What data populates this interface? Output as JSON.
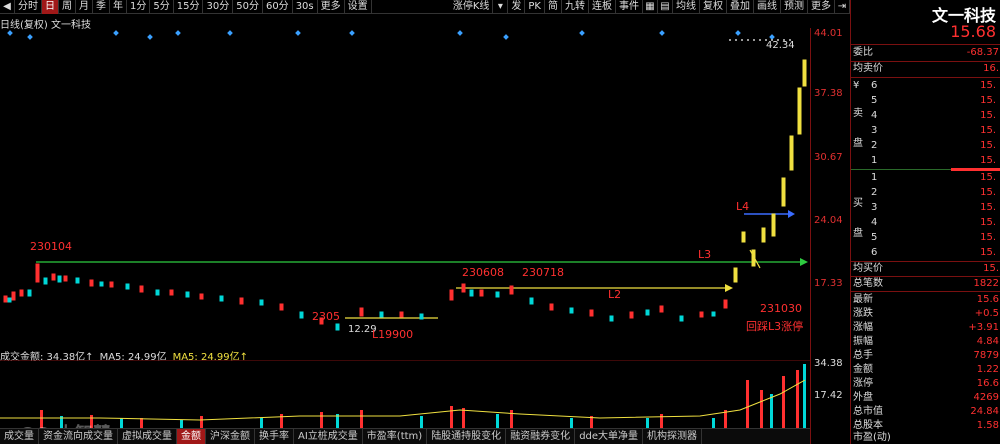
{
  "toolbar": {
    "items": [
      "分时",
      "日",
      "周",
      "月",
      "季",
      "年",
      "1分",
      "5分",
      "15分",
      "30分",
      "50分",
      "60分",
      "30s",
      "更多",
      "设置"
    ],
    "right_items": [
      "涨停K线",
      "发",
      "PK",
      "简",
      "九转",
      "连板",
      "事件",
      "均线",
      "复权",
      "叠加",
      "画线",
      "预测",
      "更多"
    ],
    "active": "日"
  },
  "stock_label": "日线(复权)  文一科技",
  "axis": {
    "price_labels": [
      "44.01",
      "42.34",
      "37.38",
      "30.67",
      "24.04",
      "17.33"
    ],
    "volume_labels": [
      "34.38",
      "17.42"
    ]
  },
  "annotations": {
    "a1": "230104",
    "a2": "230608",
    "a3": "230718",
    "a4": "L4",
    "a5": "L3",
    "a6": "L2",
    "a7": "231030",
    "a8": "回踩L3涨停",
    "a9": "2305",
    "a10": "12.29",
    "a11": "L19900"
  },
  "vol_header": {
    "name": "成交金额: 34.38亿↑",
    "ma1": "MA5: 24.99亿",
    "ma2": "MA5: 24.99亿↑"
  },
  "bottom_tabs": [
    "成交量",
    "资金流向成交量",
    "虚拟成交量",
    "金额",
    "沪深金额",
    "换手率",
    "AI立桩成交量",
    "市盈率(ttm)",
    "陆股通持股变化",
    "融资融券变化",
    "dde大单净量",
    "机构探测器"
  ],
  "active_tab": "金额",
  "right_panel": {
    "title": "文一科技",
    "price": "15.68",
    "weibi_label": "委比",
    "weibi_val": "-68.37",
    "avg_label": "均卖价",
    "avg_val": "16.",
    "sell_label": "卖",
    "sell_label2": "盘",
    "sell_marker": "¥",
    "sell_nums": [
      "6",
      "5",
      "4",
      "3",
      "2",
      "1"
    ],
    "sell_vals": [
      "15.",
      "15.",
      "15.",
      "15.",
      "15.",
      "15."
    ],
    "buy_label": "买",
    "buy_label2": "盘",
    "buy_nums": [
      "1",
      "2",
      "3",
      "4",
      "5",
      "6"
    ],
    "buy_vals": [
      "15.",
      "15.",
      "15.",
      "15.",
      "15.",
      "15."
    ],
    "stats": [
      {
        "label": "均买价",
        "val": "15."
      },
      {
        "label": "总笔数",
        "val": "1822"
      },
      {
        "label": "最新",
        "val": "15.6"
      },
      {
        "label": "涨跌",
        "val": "+0.5"
      },
      {
        "label": "涨幅",
        "val": "+3.91"
      },
      {
        "label": "振幅",
        "val": "4.84"
      },
      {
        "label": "总手",
        "val": "7879"
      },
      {
        "label": "金额",
        "val": "1.22"
      },
      {
        "label": "涨停",
        "val": "16.6"
      },
      {
        "label": "外盘",
        "val": "4269"
      },
      {
        "label": "总市值",
        "val": "24.84"
      },
      {
        "label": "总股本",
        "val": "1.58"
      },
      {
        "label": "市盈(动)",
        "val": ""
      }
    ]
  },
  "watermark": "QQ 大智慧"
}
